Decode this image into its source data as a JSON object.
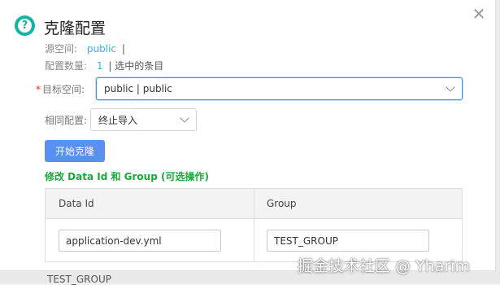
{
  "dialog": {
    "title": "克隆配置",
    "help_icon": "question-circle-icon",
    "close_icon": "close-icon"
  },
  "meta": {
    "source_label": "源空间:",
    "source_value": "public",
    "source_suffix": "|",
    "count_label": "配置数量:",
    "count_value": "1",
    "count_suffix": "| 选中的条目"
  },
  "form": {
    "target_required": "*",
    "target_label": "目标空间:",
    "target_value": "public | public",
    "same_config_label": "相同配置:",
    "same_config_value": "终止导入",
    "start_button": "开始克隆",
    "edit_hint": "修改 Data Id 和 Group (可选操作)"
  },
  "table": {
    "headers": [
      "Data Id",
      "Group"
    ],
    "rows": [
      {
        "data_id": "application-dev.yml",
        "group": "TEST_GROUP"
      }
    ]
  },
  "background": {
    "peek_text": "TEST_GROUP"
  },
  "watermark": "掘金技术社区 @ Yharim",
  "colors": {
    "accent": "#13b5a0",
    "primary_button": "#5a90f2",
    "link_value": "#2db7f5",
    "hint_green": "#19a83a",
    "required": "#f5222d"
  }
}
